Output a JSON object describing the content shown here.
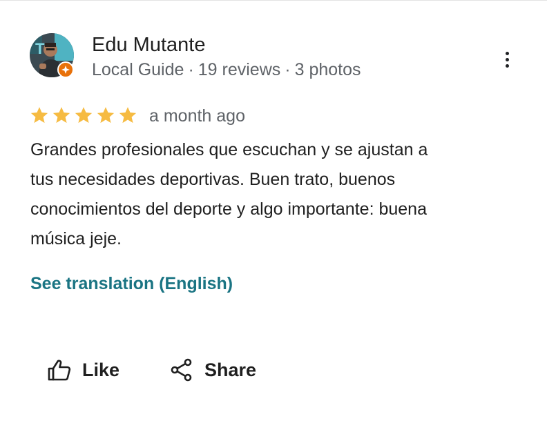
{
  "author": {
    "name": "Edu Mutante",
    "badge": "Local Guide",
    "reviews": "19 reviews",
    "photos": "3 photos",
    "separator": "·",
    "avatar_icon": "user-photo",
    "badge_icon": "local-guide-star-icon",
    "badge_color": "#e8710a"
  },
  "review": {
    "rating": 5,
    "rating_max": 5,
    "star_color": "#f6bb42",
    "date": "a month ago",
    "text_lines": [
      "Grandes profesionales que escuchan y se ajustan a",
      "tus necesidades deportivas. Buen trato, buenos",
      "conocimientos del deporte y algo importante: buena",
      "música jeje."
    ],
    "translate_label": "See translation (English)",
    "link_color": "#1a7483"
  },
  "actions": {
    "like_label": "Like",
    "share_label": "Share",
    "like_icon": "thumbs-up-icon",
    "share_icon": "share-icon"
  },
  "menu": {
    "more_icon": "more-vertical-icon"
  }
}
